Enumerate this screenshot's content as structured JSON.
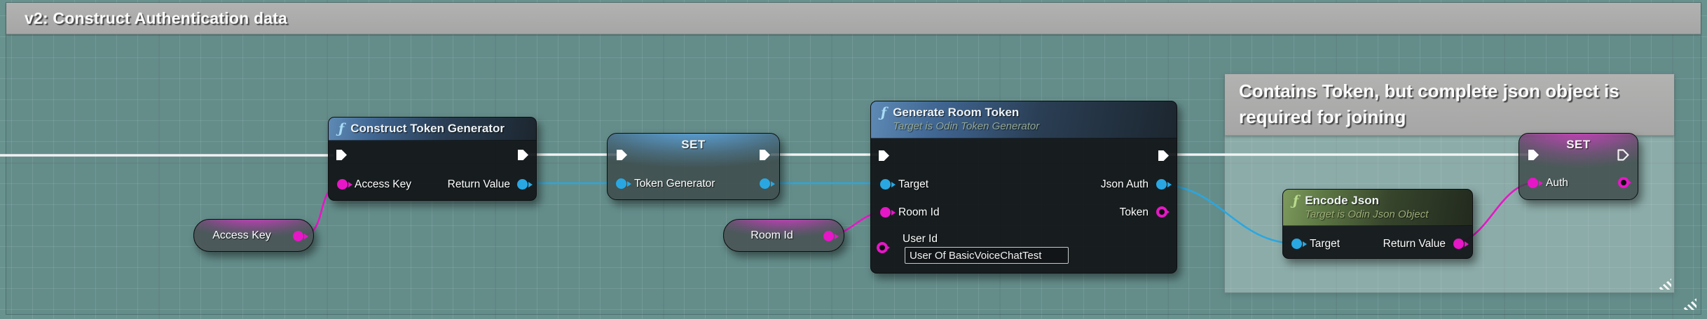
{
  "comment_v2": {
    "title": "v2: Construct Authentication data"
  },
  "comment_json": {
    "title": "Contains Token, but complete json object is required for joining"
  },
  "nodes": {
    "construct_token_generator": {
      "icon": "ƒ",
      "title": "Construct Token Generator",
      "access_key": "Access Key",
      "return_value": "Return Value"
    },
    "set_token_generator": {
      "title": "SET",
      "variable": "Token Generator"
    },
    "generate_room_token": {
      "icon": "ƒ",
      "title": "Generate Room Token",
      "subtitle": "Target is Odin Token Generator",
      "target": "Target",
      "room_id": "Room Id",
      "user_id": "User Id",
      "json_auth": "Json Auth",
      "token": "Token",
      "user_id_value": "User Of BasicVoiceChatTest"
    },
    "encode_json": {
      "icon": "ƒ",
      "title": "Encode Json",
      "subtitle": "Target is Odin Json Object",
      "target": "Target",
      "return_value": "Return Value"
    },
    "set_auth": {
      "title": "SET",
      "variable": "Auth"
    },
    "get_access_key": {
      "label": "Access Key"
    },
    "get_room_id": {
      "label": "Room Id"
    }
  },
  "colors": {
    "exec": "#f2f2f2",
    "object_pin": "#29a7e2",
    "string_pin": "#e617c6",
    "comment_header": "#a9a9a9",
    "grid_bg": "#68928e"
  }
}
